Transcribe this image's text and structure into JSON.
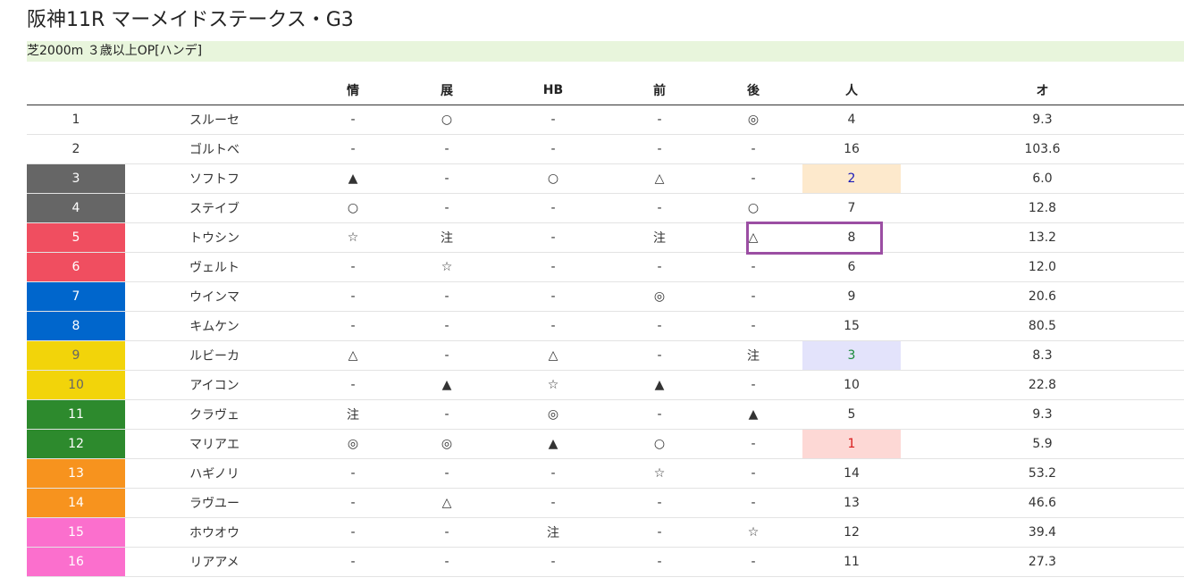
{
  "page": {
    "title": "阪神11R マーメイドステークス・G3",
    "subtitle": "芝2000m ３歳以上OP[ハンデ]"
  },
  "table": {
    "headers": [
      "",
      "",
      "情",
      "展",
      "HB",
      "前",
      "後",
      "人",
      "オ"
    ],
    "rows": [
      {
        "num": "1",
        "name": "スルーセ",
        "jo": "-",
        "ten": "○",
        "hb": "-",
        "mae": "-",
        "ato": "◎",
        "pop": "4",
        "odds": "9.3",
        "num_bg": "#ffffff",
        "num_color": "#333333",
        "pop_bg": "",
        "pop_color": ""
      },
      {
        "num": "2",
        "name": "ゴルトベ",
        "jo": "-",
        "ten": "-",
        "hb": "-",
        "mae": "-",
        "ato": "-",
        "pop": "16",
        "odds": "103.6",
        "num_bg": "#ffffff",
        "num_color": "#333333",
        "pop_bg": "",
        "pop_color": ""
      },
      {
        "num": "3",
        "name": "ソフトフ",
        "jo": "▲",
        "ten": "-",
        "hb": "○",
        "mae": "△",
        "ato": "-",
        "pop": "2",
        "odds": "6.0",
        "num_bg": "#666666",
        "num_color": "#ffffff",
        "pop_bg": "#fde9cc",
        "pop_color": "#1a1ab8"
      },
      {
        "num": "4",
        "name": "ステイブ",
        "jo": "○",
        "ten": "-",
        "hb": "-",
        "mae": "-",
        "ato": "○",
        "pop": "7",
        "odds": "12.8",
        "num_bg": "#666666",
        "num_color": "#ffffff",
        "pop_bg": "",
        "pop_color": ""
      },
      {
        "num": "5",
        "name": "トウシン",
        "jo": "☆",
        "ten": "注",
        "hb": "-",
        "mae": "注",
        "ato": "△",
        "pop": "8",
        "odds": "13.2",
        "num_bg": "#f04e60",
        "num_color": "#ffffff",
        "pop_bg": "",
        "pop_color": ""
      },
      {
        "num": "6",
        "name": "ヴェルト",
        "jo": "-",
        "ten": "☆",
        "hb": "-",
        "mae": "-",
        "ato": "-",
        "pop": "6",
        "odds": "12.0",
        "num_bg": "#f04e60",
        "num_color": "#ffffff",
        "pop_bg": "",
        "pop_color": ""
      },
      {
        "num": "7",
        "name": "ウインマ",
        "jo": "-",
        "ten": "-",
        "hb": "-",
        "mae": "◎",
        "ato": "-",
        "pop": "9",
        "odds": "20.6",
        "num_bg": "#0066cc",
        "num_color": "#ffffff",
        "pop_bg": "",
        "pop_color": ""
      },
      {
        "num": "8",
        "name": "キムケン",
        "jo": "-",
        "ten": "-",
        "hb": "-",
        "mae": "-",
        "ato": "-",
        "pop": "15",
        "odds": "80.5",
        "num_bg": "#0066cc",
        "num_color": "#ffffff",
        "pop_bg": "",
        "pop_color": ""
      },
      {
        "num": "9",
        "name": "ルビーカ",
        "jo": "△",
        "ten": "-",
        "hb": "△",
        "mae": "-",
        "ato": "注",
        "pop": "3",
        "odds": "8.3",
        "num_bg": "#f2d40a",
        "num_color": "#666666",
        "pop_bg": "#e3e3fb",
        "pop_color": "#1a8a3a"
      },
      {
        "num": "10",
        "name": "アイコン",
        "jo": "-",
        "ten": "▲",
        "hb": "☆",
        "mae": "▲",
        "ato": "-",
        "pop": "10",
        "odds": "22.8",
        "num_bg": "#f2d40a",
        "num_color": "#666666",
        "pop_bg": "",
        "pop_color": ""
      },
      {
        "num": "11",
        "name": "クラヴェ",
        "jo": "注",
        "ten": "-",
        "hb": "◎",
        "mae": "-",
        "ato": "▲",
        "pop": "5",
        "odds": "9.3",
        "num_bg": "#2d8a2d",
        "num_color": "#ffffff",
        "pop_bg": "",
        "pop_color": ""
      },
      {
        "num": "12",
        "name": "マリアエ",
        "jo": "◎",
        "ten": "◎",
        "hb": "▲",
        "mae": "○",
        "ato": "-",
        "pop": "1",
        "odds": "5.9",
        "num_bg": "#2d8a2d",
        "num_color": "#ffffff",
        "pop_bg": "#fdd8d5",
        "pop_color": "#d81b1b"
      },
      {
        "num": "13",
        "name": "ハギノリ",
        "jo": "-",
        "ten": "-",
        "hb": "-",
        "mae": "☆",
        "ato": "-",
        "pop": "14",
        "odds": "53.2",
        "num_bg": "#f7931e",
        "num_color": "#ffffff",
        "pop_bg": "",
        "pop_color": ""
      },
      {
        "num": "14",
        "name": "ラヴユー",
        "jo": "-",
        "ten": "△",
        "hb": "-",
        "mae": "-",
        "ato": "-",
        "pop": "13",
        "odds": "46.6",
        "num_bg": "#f7931e",
        "num_color": "#ffffff",
        "pop_bg": "",
        "pop_color": ""
      },
      {
        "num": "15",
        "name": "ホウオウ",
        "jo": "-",
        "ten": "-",
        "hb": "注",
        "mae": "-",
        "ato": "☆",
        "pop": "12",
        "odds": "39.4",
        "num_bg": "#fb6fcd",
        "num_color": "#ffffff",
        "pop_bg": "",
        "pop_color": ""
      },
      {
        "num": "16",
        "name": "リアアメ",
        "jo": "-",
        "ten": "-",
        "hb": "-",
        "mae": "-",
        "ato": "-",
        "pop": "11",
        "odds": "27.3",
        "num_bg": "#fb6fcd",
        "num_color": "#ffffff",
        "pop_bg": "",
        "pop_color": ""
      }
    ]
  },
  "colors": {
    "subtitle_bg": "#e8f5dc",
    "highlight_border": "#9b4ea3"
  }
}
